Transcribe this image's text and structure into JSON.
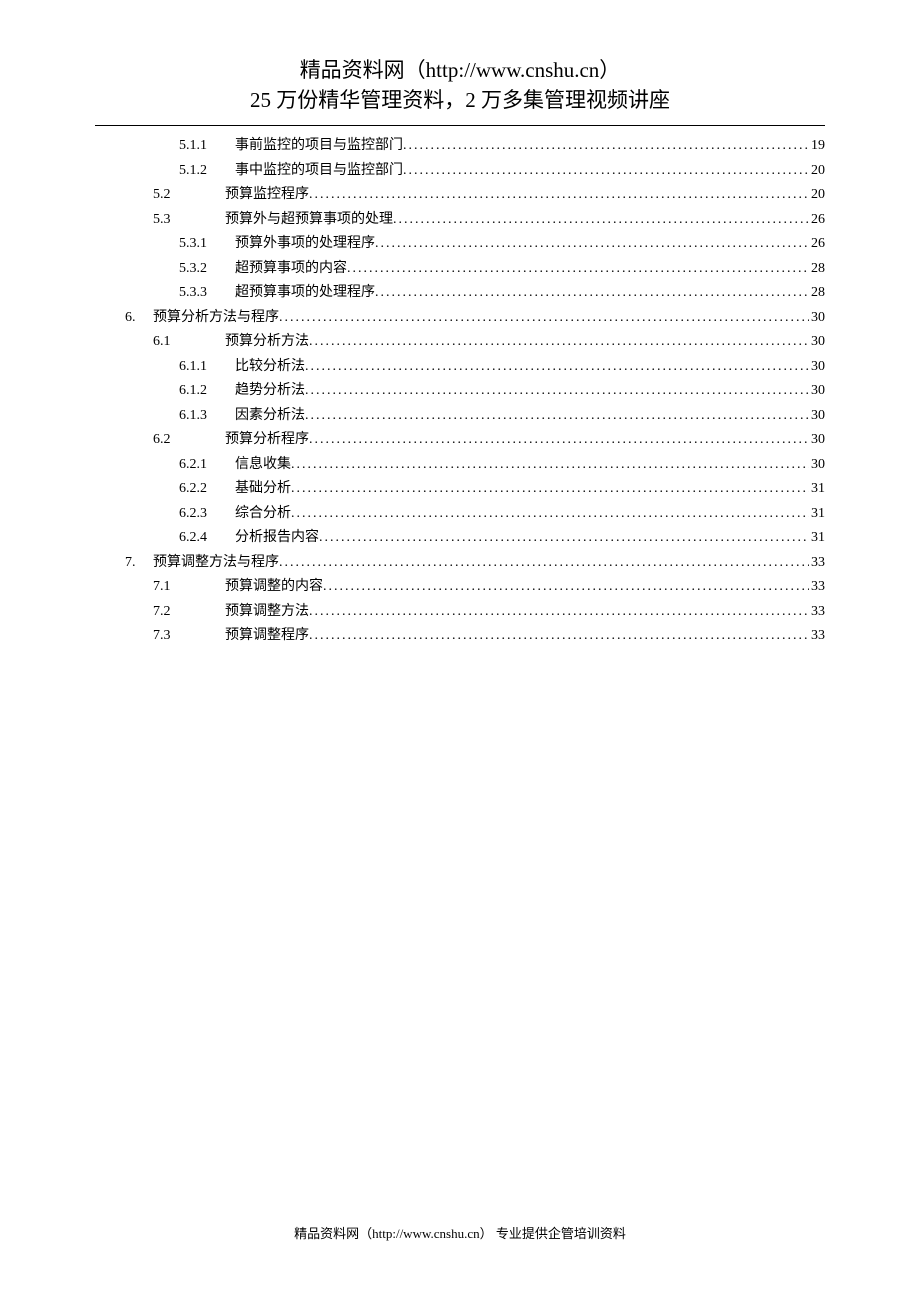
{
  "header": {
    "line1": "精品资料网（http://www.cnshu.cn）",
    "line2": "25 万份精华管理资料，2 万多集管理视频讲座"
  },
  "toc": [
    {
      "level": 3,
      "num": "5.1.1",
      "title": "事前监控的项目与监控部门",
      "page": "19"
    },
    {
      "level": 3,
      "num": "5.1.2",
      "title": "事中监控的项目与监控部门",
      "page": "20"
    },
    {
      "level": 2,
      "num": "5.2",
      "title": "预算监控程序",
      "page": "20"
    },
    {
      "level": 2,
      "num": "5.3",
      "title": "预算外与超预算事项的处理",
      "page": "26"
    },
    {
      "level": 3,
      "num": "5.3.1",
      "title": "预算外事项的处理程序",
      "page": "26"
    },
    {
      "level": 3,
      "num": "5.3.2",
      "title": "超预算事项的内容",
      "page": "28"
    },
    {
      "level": 3,
      "num": "5.3.3",
      "title": "超预算事项的处理程序",
      "page": "28"
    },
    {
      "level": 1,
      "num": "6.",
      "title": "预算分析方法与程序",
      "page": "30"
    },
    {
      "level": 2,
      "num": "6.1",
      "title": "预算分析方法",
      "page": "30"
    },
    {
      "level": 3,
      "num": "6.1.1",
      "title": "比较分析法",
      "page": "30"
    },
    {
      "level": 3,
      "num": "6.1.2",
      "title": "趋势分析法",
      "page": "30"
    },
    {
      "level": 3,
      "num": "6.1.3",
      "title": "因素分析法",
      "page": "30"
    },
    {
      "level": 2,
      "num": "6.2",
      "title": "预算分析程序",
      "page": "30"
    },
    {
      "level": 3,
      "num": "6.2.1",
      "title": "信息收集",
      "page": "30"
    },
    {
      "level": 3,
      "num": "6.2.2",
      "title": "基础分析",
      "page": "31"
    },
    {
      "level": 3,
      "num": "6.2.3",
      "title": "综合分析",
      "page": "31"
    },
    {
      "level": 3,
      "num": "6.2.4",
      "title": "分析报告内容",
      "page": "31"
    },
    {
      "level": 1,
      "num": "7.",
      "title": "预算调整方法与程序",
      "page": "33"
    },
    {
      "level": 2,
      "num": "7.1",
      "title": "预算调整的内容",
      "page": "33"
    },
    {
      "level": 2,
      "num": "7.2",
      "title": "预算调整方法",
      "page": "33"
    },
    {
      "level": 2,
      "num": "7.3",
      "title": "预算调整程序",
      "page": "33"
    }
  ],
  "footer": {
    "text": "精品资料网（http://www.cnshu.cn）  专业提供企管培训资料"
  }
}
